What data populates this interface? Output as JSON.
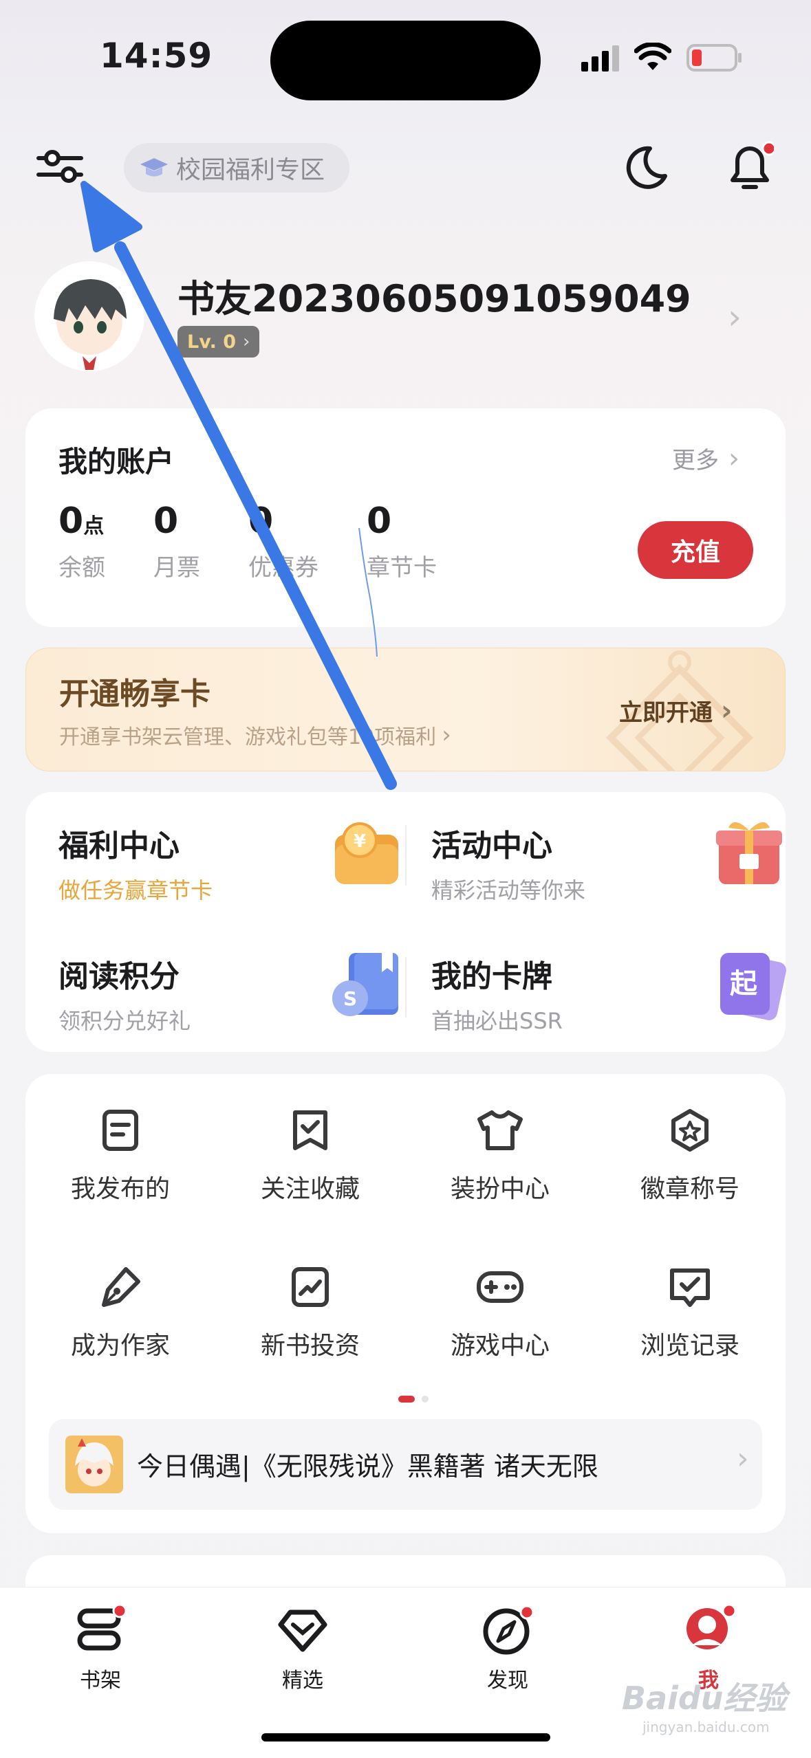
{
  "status_bar": {
    "time": "14:59"
  },
  "header": {
    "campus_label": "校园福利专区"
  },
  "profile": {
    "username": "书友20230605091059049",
    "level": "Lv. 0"
  },
  "account": {
    "title": "我的账户",
    "more": "更多",
    "stats": [
      {
        "value": "0",
        "unit": "点",
        "label": "余额"
      },
      {
        "value": "0",
        "unit": "",
        "label": "月票"
      },
      {
        "value": "0",
        "unit": "",
        "label": "优惠券"
      },
      {
        "value": "0",
        "unit": "",
        "label": "章节卡"
      }
    ],
    "recharge": "充值"
  },
  "vip": {
    "title": "开通畅享卡",
    "subtitle": "开通享书架云管理、游戏礼包等10项福利",
    "action": "立即开通"
  },
  "features": [
    {
      "title": "福利中心",
      "subtitle": "做任务赢章节卡",
      "icon": "coin-wallet-icon"
    },
    {
      "title": "活动中心",
      "subtitle": "精彩活动等你来",
      "icon": "gift-box-icon"
    },
    {
      "title": "阅读积分",
      "subtitle": "领积分兑好礼",
      "icon": "points-book-icon"
    },
    {
      "title": "我的卡牌",
      "subtitle": "首抽必出SSR",
      "icon": "card-deck-icon"
    }
  ],
  "tools": [
    {
      "label": "我发布的",
      "icon": "document-icon"
    },
    {
      "label": "关注收藏",
      "icon": "bookmark-check-icon"
    },
    {
      "label": "装扮中心",
      "icon": "tshirt-icon"
    },
    {
      "label": "徽章称号",
      "icon": "badge-icon"
    },
    {
      "label": "成为作家",
      "icon": "pen-icon"
    },
    {
      "label": "新书投资",
      "icon": "trend-chart-icon"
    },
    {
      "label": "游戏中心",
      "icon": "gamepad-icon"
    },
    {
      "label": "浏览记录",
      "icon": "history-book-icon"
    }
  ],
  "recommend": {
    "text": "今日偶遇|《无限残说》黑籍著 诸天无限"
  },
  "tabbar": [
    {
      "label": "书架",
      "icon": "bookshelf-icon",
      "dot": true
    },
    {
      "label": "精选",
      "icon": "diamond-icon",
      "dot": false
    },
    {
      "label": "发现",
      "icon": "compass-icon",
      "dot": true
    },
    {
      "label": "我",
      "icon": "profile-icon",
      "dot": true
    }
  ],
  "watermark": {
    "text": "Baidu经验",
    "sub": "jingyan.baidu.com"
  },
  "colors": {
    "accent_red": "#d8353d",
    "orange": "#e8a53a",
    "arrow_blue": "#3a78e6"
  }
}
